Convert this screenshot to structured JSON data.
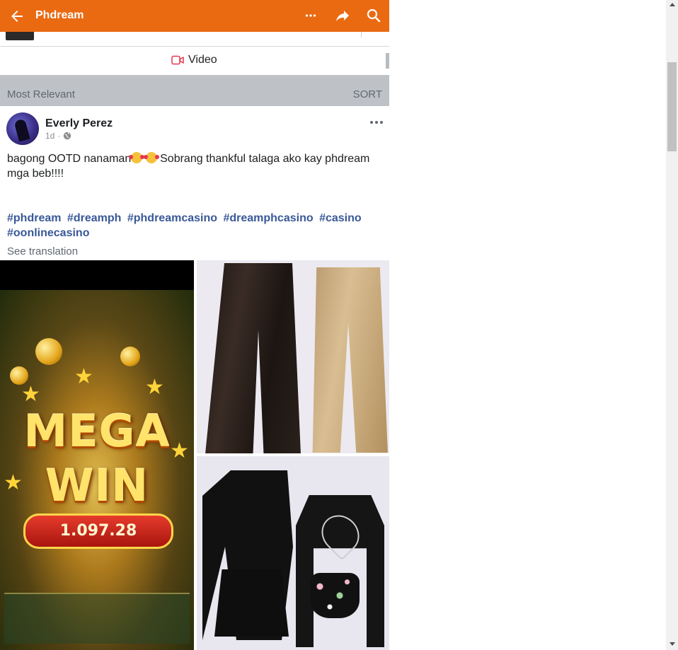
{
  "header": {
    "title": "Phdream",
    "back_icon": "arrow-left-icon",
    "more_icon": "more-horizontal-icon",
    "share_icon": "share-icon",
    "search_icon": "search-icon",
    "background_color": "#ea6a12"
  },
  "video_tab": {
    "label": "Video",
    "icon": "video-camera-icon",
    "icon_color": "#e4384d"
  },
  "sort_bar": {
    "label": "Most Relevant",
    "sort_label": "SORT"
  },
  "post": {
    "author": "Everly Perez",
    "time": "1d",
    "separator": "·",
    "audience_icon": "globe-icon",
    "text_part1": "bagong OOTD nanaman",
    "text_part2": " Sobrang thankful talaga ako kay phdream mga beb!!!!",
    "hashtags": [
      "#phdream",
      "#dreamph",
      "#phdreamcasino",
      "#dreamphcasino",
      "#casino",
      "#oonlinecasino"
    ],
    "see_translation": "See translation",
    "images": {
      "left": {
        "line1": "MEGA",
        "line2": "WIN",
        "amount": "1.097.28"
      }
    },
    "link_color": "#385898"
  }
}
